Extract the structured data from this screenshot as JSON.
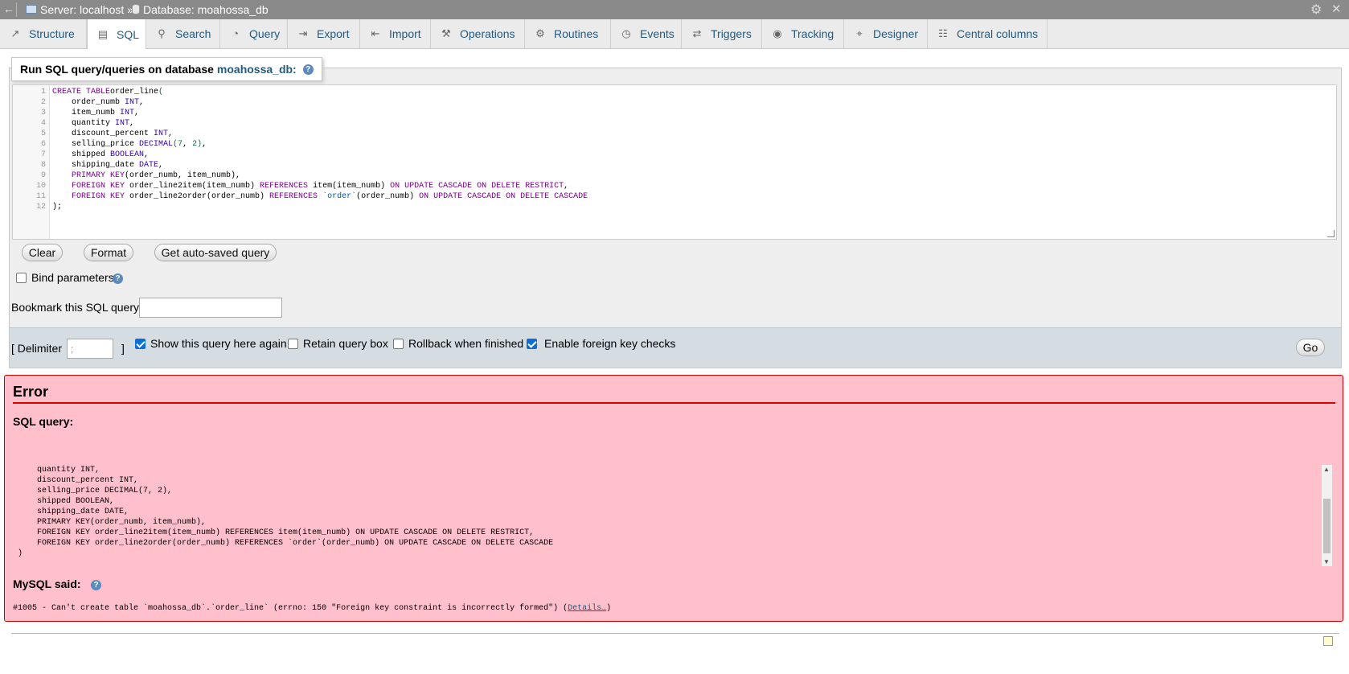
{
  "topbar": {
    "back": "←",
    "server_label": "Server: localhost »",
    "db_label": "Database: moahossa_db"
  },
  "tabs": [
    {
      "label": "Structure",
      "icon": "structure-icon",
      "glyph": "↗"
    },
    {
      "label": "SQL",
      "icon": "sql-icon",
      "glyph": "▤"
    },
    {
      "label": "Search",
      "icon": "search-icon",
      "glyph": "⚲"
    },
    {
      "label": "Query",
      "icon": "query-icon",
      "glyph": "◔"
    },
    {
      "label": "Export",
      "icon": "export-icon",
      "glyph": "⇥"
    },
    {
      "label": "Import",
      "icon": "import-icon",
      "glyph": "⇤"
    },
    {
      "label": "Operations",
      "icon": "wrench-icon",
      "glyph": "⚒"
    },
    {
      "label": "Routines",
      "icon": "routines-icon",
      "glyph": "⚙"
    },
    {
      "label": "Events",
      "icon": "clock-icon",
      "glyph": "◷"
    },
    {
      "label": "Triggers",
      "icon": "triggers-icon",
      "glyph": "⇄"
    },
    {
      "label": "Tracking",
      "icon": "eye-icon",
      "glyph": "◉"
    },
    {
      "label": "Designer",
      "icon": "designer-icon",
      "glyph": "⌖"
    },
    {
      "label": "Central columns",
      "icon": "central-columns-icon",
      "glyph": "☷"
    }
  ],
  "sql_panel": {
    "legend_prefix": "Run SQL query/queries on database",
    "legend_db": "moahossa_db:",
    "clear_label": "Clear",
    "format_label": "Format",
    "autosaved_label": "Get auto-saved query",
    "bind_params_label": "Bind parameters",
    "bookmark_label": "Bookmark this SQL query:",
    "bookmark_value": ""
  },
  "editor_lines": [
    {
      "n": "1",
      "parts": [
        [
          "kw",
          "CREATE TABLE"
        ],
        [
          "",
          "order_line"
        ],
        [
          "nm",
          "("
        ]
      ]
    },
    {
      "n": "2",
      "parts": [
        [
          "",
          "    order_numb "
        ],
        [
          "ty",
          "INT"
        ],
        [
          "",
          ","
        ]
      ]
    },
    {
      "n": "3",
      "parts": [
        [
          "",
          "    item_numb "
        ],
        [
          "ty",
          "INT"
        ],
        [
          "",
          ","
        ]
      ]
    },
    {
      "n": "4",
      "parts": [
        [
          "",
          "    quantity "
        ],
        [
          "ty",
          "INT"
        ],
        [
          "",
          ","
        ]
      ]
    },
    {
      "n": "5",
      "parts": [
        [
          "",
          "    discount_percent "
        ],
        [
          "ty",
          "INT"
        ],
        [
          "",
          ","
        ]
      ]
    },
    {
      "n": "6",
      "parts": [
        [
          "",
          "    selling_price "
        ],
        [
          "ty",
          "DECIMAL"
        ],
        [
          "nm",
          "("
        ],
        [
          "nm",
          "7"
        ],
        [
          "",
          ", "
        ],
        [
          "nm",
          "2"
        ],
        [
          "nm",
          ")"
        ],
        [
          "",
          ","
        ]
      ]
    },
    {
      "n": "7",
      "parts": [
        [
          "",
          "    shipped "
        ],
        [
          "ty",
          "BOOLEAN"
        ],
        [
          "",
          ","
        ]
      ]
    },
    {
      "n": "8",
      "parts": [
        [
          "",
          "    shipping_date "
        ],
        [
          "ty",
          "DATE"
        ],
        [
          "",
          ","
        ]
      ]
    },
    {
      "n": "9",
      "parts": [
        [
          "kw",
          "    PRIMARY KEY"
        ],
        [
          "",
          "(order_numb, item_numb),"
        ]
      ]
    },
    {
      "n": "10",
      "parts": [
        [
          "kw",
          "    FOREIGN KEY"
        ],
        [
          "",
          " order_line2item(item_numb) "
        ],
        [
          "kw",
          "REFERENCES"
        ],
        [
          "",
          " item(item_numb) "
        ],
        [
          "kw",
          "ON UPDATE CASCADE ON DELETE RESTRICT"
        ],
        [
          "",
          ","
        ]
      ]
    },
    {
      "n": "11",
      "parts": [
        [
          "kw",
          "    FOREIGN KEY"
        ],
        [
          "",
          " order_line2order(order_numb) "
        ],
        [
          "kw",
          "REFERENCES"
        ],
        [
          "",
          " "
        ],
        [
          "bt",
          "`order`"
        ],
        [
          "",
          "(order_numb) "
        ],
        [
          "kw",
          "ON UPDATE CASCADE ON DELETE CASCADE"
        ]
      ]
    },
    {
      "n": "12",
      "parts": [
        [
          "",
          ");"
        ]
      ]
    }
  ],
  "options": {
    "delimiter_open": "[ Delimiter",
    "delimiter_value": ";",
    "delimiter_close": "]",
    "show_again_label": "Show this query here again",
    "show_again_checked": true,
    "retain_label": "Retain query box",
    "retain_checked": false,
    "rollback_label": "Rollback when finished",
    "rollback_checked": false,
    "fk_checks_label": "Enable foreign key checks",
    "fk_checks_checked": true,
    "go_label": "Go"
  },
  "error": {
    "title": "Error",
    "sql_query_label": "SQL query:",
    "query_lines": [
      "    quantity INT,",
      "    discount_percent INT,",
      "    selling_price DECIMAL(7, 2),",
      "    shipped BOOLEAN,",
      "    shipping_date DATE,",
      "    PRIMARY KEY(order_numb, item_numb),",
      "    FOREIGN KEY order_line2item(item_numb) REFERENCES item(item_numb) ON UPDATE CASCADE ON DELETE RESTRICT,",
      "    FOREIGN KEY order_line2order(order_numb) REFERENCES `order`(order_numb) ON UPDATE CASCADE ON DELETE CASCADE",
      ")"
    ],
    "mysql_said_label": "MySQL said:",
    "message": "#1005 - Can't create table `moahossa_db`.`order_line` (errno: 150 \"Foreign key constraint is incorrectly formed\") (",
    "details_link": "Details…",
    "message_end": ")"
  },
  "colors": {
    "link": "#235a81",
    "error_bg": "#ffc0cb",
    "error_border": "#cc0000"
  }
}
